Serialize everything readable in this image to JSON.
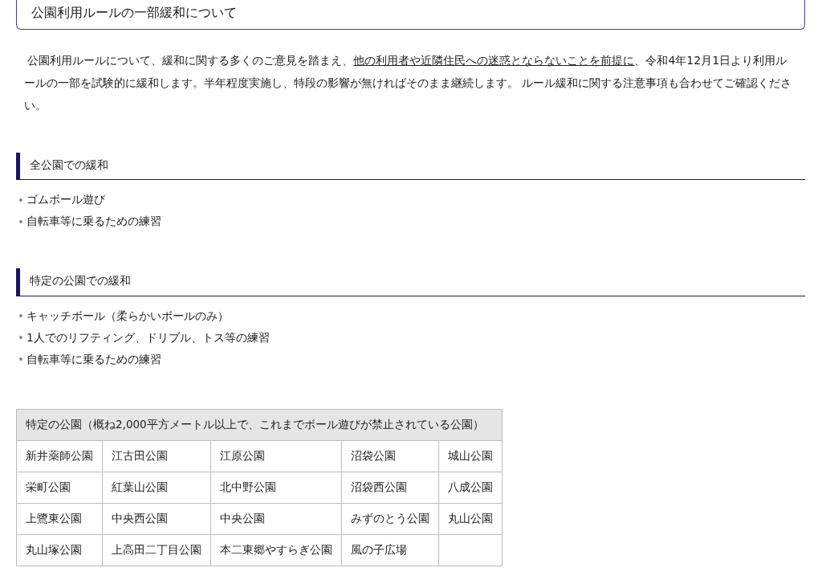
{
  "title": "公園利用ルールの一部緩和について",
  "intro": {
    "before": "公園利用ルールについて、緩和に関する多くのご意見を踏まえ、",
    "underlined": "他の利用者や近隣住民への迷惑とならないことを前提に",
    "after": "、令和4年12月1日より利用ルールの一部を試験的に緩和します。半年程度実施し、特段の影響が無ければそのまま継続します。 ルール緩和に関する注意事項も合わせてご確認ください。"
  },
  "sections": [
    {
      "heading": "全公園での緩和",
      "items": [
        "ゴムボール遊び",
        "自転車等に乗るための練習"
      ]
    },
    {
      "heading": "特定の公園での緩和",
      "items": [
        "キャッチボール（柔らかいボールのみ）",
        "1人でのリフティング、ドリブル、トス等の練習",
        "自転車等に乗るための練習"
      ]
    }
  ],
  "table": {
    "caption": "特定の公園（概ね2,000平方メートル以上で、これまでボール遊びが禁止されている公園）",
    "rows": [
      [
        "新井薬師公園",
        "江古田公園",
        "江原公園",
        "沼袋公園",
        "城山公園"
      ],
      [
        "栄町公園",
        "紅葉山公園",
        "北中野公園",
        "沼袋西公園",
        "八成公園"
      ],
      [
        "上鷺東公園",
        "中央西公園",
        "中央公園",
        "みずのとう公園",
        "丸山公園"
      ],
      [
        "丸山塚公園",
        "上高田二丁目公園",
        "本二東郷やすらぎ公園",
        "風の子広場"
      ]
    ]
  }
}
